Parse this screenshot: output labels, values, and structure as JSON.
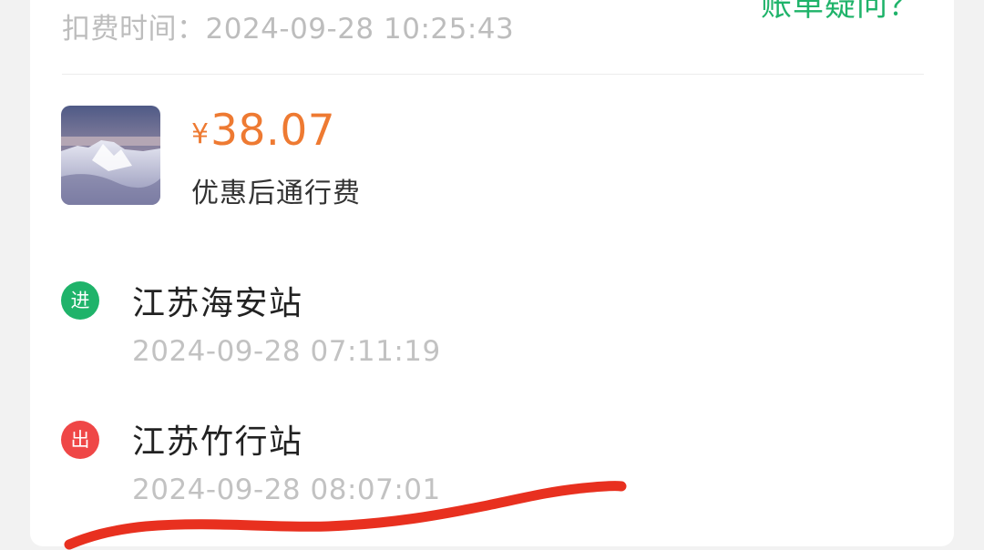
{
  "bill": {
    "deduct_label": "扣费时间：",
    "deduct_time": "2024-09-28 10:25:43",
    "dispute_link": "账单疑问？",
    "currency_symbol": "¥",
    "amount": "38.07",
    "amount_label": "优惠后通行费"
  },
  "entry": {
    "badge": "进",
    "station": "江苏海安站",
    "time": "2024-09-28 07:11:19"
  },
  "exit": {
    "badge": "出",
    "station": "江苏竹行站",
    "time": "2024-09-28 08:07:01"
  },
  "colors": {
    "accent_green": "#1fb36a",
    "amount_orange": "#ee7a32",
    "exit_red": "#ef4747",
    "scribble_red": "#e8301f"
  },
  "icons": {
    "thumbnail": "snowy-lake-landscape-image",
    "entry_badge": "entry-badge-icon",
    "exit_badge": "exit-badge-icon"
  }
}
